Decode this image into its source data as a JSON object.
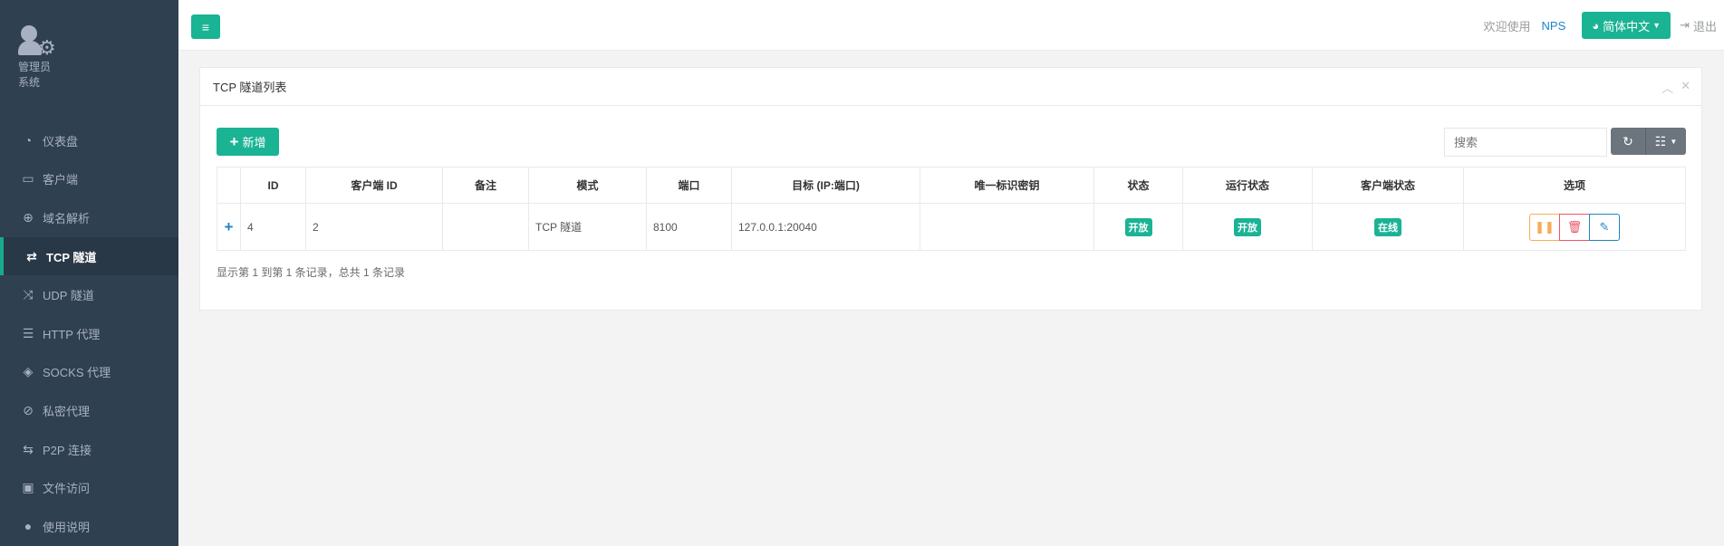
{
  "sidebar": {
    "profile_name": "管理员",
    "profile_role": "系统",
    "items": [
      {
        "label": "仪表盘",
        "icon": "dashboard-icon"
      },
      {
        "label": "客户端",
        "icon": "monitor-icon"
      },
      {
        "label": "域名解析",
        "icon": "globe-icon"
      },
      {
        "label": "TCP 隧道",
        "icon": "retweet-icon",
        "active": true
      },
      {
        "label": "UDP 隧道",
        "icon": "random-icon"
      },
      {
        "label": "HTTP 代理",
        "icon": "server-icon"
      },
      {
        "label": "SOCKS 代理",
        "icon": "layers-icon"
      },
      {
        "label": "私密代理",
        "icon": "eye-slash-icon"
      },
      {
        "label": "P2P 连接",
        "icon": "exchange-icon"
      },
      {
        "label": "文件访问",
        "icon": "briefcase-icon"
      },
      {
        "label": "使用说明",
        "icon": "lightbulb-icon"
      }
    ]
  },
  "topbar": {
    "welcome": "欢迎使用",
    "brand": "NPS",
    "language": "简体中文",
    "logout": "退出"
  },
  "panel": {
    "title": "TCP 隧道列表",
    "add_label": "新增",
    "search_placeholder": "搜索",
    "columns": [
      "ID",
      "客户端 ID",
      "备注",
      "模式",
      "端口",
      "目标 (IP:端口)",
      "唯一标识密钥",
      "状态",
      "运行状态",
      "客户端状态",
      "选项"
    ],
    "rows": [
      {
        "id": "4",
        "client_id": "2",
        "remark": "",
        "mode": "TCP 隧道",
        "port": "8100",
        "target": "127.0.0.1:20040",
        "key": "",
        "status": "开放",
        "run_status": "开放",
        "client_status": "在线"
      }
    ],
    "footer": "显示第 1 到第 1 条记录，总共 1 条记录"
  },
  "colors": {
    "sidebar_bg": "#2f4050",
    "primary": "#1ab394",
    "warning": "#f8ac59",
    "danger": "#ed5565",
    "info": "#1c84c6"
  }
}
